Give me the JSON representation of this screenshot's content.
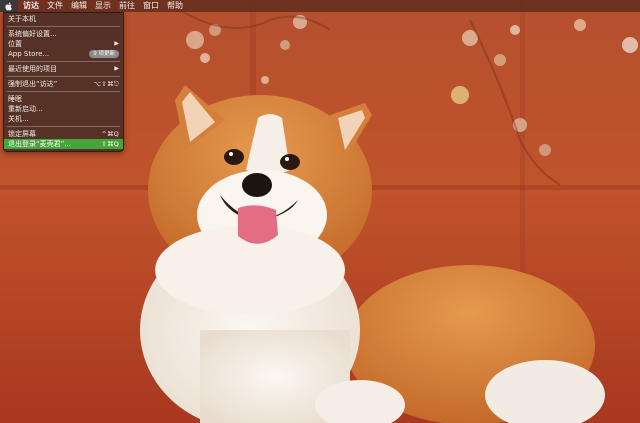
{
  "menubar": {
    "apple_icon": "apple-logo-icon",
    "items": [
      "访达",
      "文件",
      "编辑",
      "显示",
      "前往",
      "窗口",
      "帮助"
    ]
  },
  "apple_menu": {
    "about": "关于本机",
    "system_prefs": "系统偏好设置...",
    "location": "位置",
    "app_store": "App Store...",
    "app_store_badge": "9 项更新",
    "recent_items": "最近使用的项目",
    "force_quit": "强制退出“访达”",
    "force_quit_shortcut": "⌥⇧⌘⎋",
    "sleep": "睡眠",
    "restart": "重新启动...",
    "shutdown": "关机...",
    "lock_screen": "锁定屏幕",
    "lock_screen_shortcut": "^⌘Q",
    "logout": "退出登录“麦壳君”...",
    "logout_shortcut": "⇧⌘Q",
    "submenu_arrow": "▶"
  },
  "colors": {
    "wallpaper_red": "#b84a2a",
    "highlight_green": "#45a53a",
    "menu_bg": "#4e2e26"
  },
  "wallpaper": {
    "subject": "corgi-photo"
  }
}
